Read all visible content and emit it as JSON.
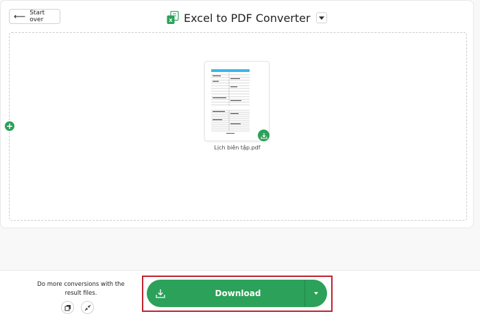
{
  "header": {
    "start_over_label": "Start over",
    "title": "Excel to PDF Converter",
    "app_icon_letter": "X"
  },
  "files": [
    {
      "name": "Lịch biên tập.pdf"
    }
  ],
  "footer": {
    "more_conversions_text": "Do more conversions with the result files.",
    "download_label": "Download"
  },
  "colors": {
    "accent_green": "#2ba159",
    "highlight_red": "#c0202b"
  }
}
